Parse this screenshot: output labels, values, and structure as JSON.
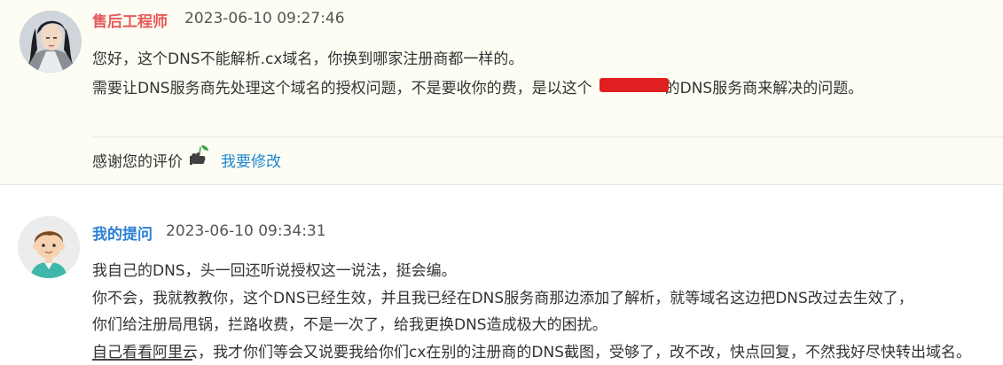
{
  "reply": {
    "author": "售后工程师",
    "time": "2023-06-10 09:27:46",
    "lines": [
      "您好，这个DNS不能解析.cx域名，你换到哪家注册商都一样的。",
      "需要让DNS服务商先处理这个域名的授权问题，不是要收你的费，是以这个",
      "的DNS服务商来解决的问题。"
    ],
    "rating_label": "感谢您的评价",
    "rating_icon": "thumb-plant-icon",
    "edit_label": "我要修改"
  },
  "question": {
    "author": "我的提问",
    "time": "2023-06-10 09:34:31",
    "lines": [
      "我自己的DNS，头一回还听说授权这一说法，挺会编。",
      "你不会，我就教教你，这个DNS已经生效，并且我已经在DNS服务商那边添加了解析，就等域名这边把DNS改过去生效了，",
      "你们给注册局甩锅，拦路收费，不是一次了，给我更换DNS造成极大的困扰。",
      "自己看看阿里云，我才你们等会又说要我给你们cx在别的注册商的DNS截图，受够了，改不改，快点回复，不然我好尽快转出域名。"
    ]
  },
  "colors": {
    "reply_bg": "#fdfdf3",
    "engineer_name": "#e8585a",
    "asker_name": "#2d7fd3",
    "link": "#1f86d1",
    "redaction": "#e02020"
  }
}
